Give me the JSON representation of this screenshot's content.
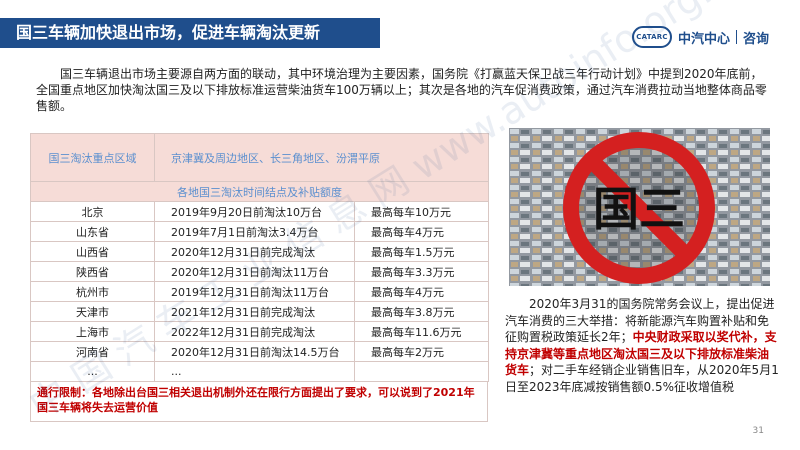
{
  "title": "国三车辆加快退出市场，促进车辆淘汰更新",
  "logo": {
    "badge_text": "CATARC",
    "name": "中汽中心",
    "sub": "咨询"
  },
  "intro": "国三车辆退出市场主要源自两方面的联动，其中环境治理为主要因素，国务院《打赢蓝天保卫战三年行动计划》中提到2020年底前，全国重点地区加快淘汰国三及以下排放标准运营柴油货车100万辆以上；其次是各地的汽车促消费政策，通过汽车消费拉动当地整体商品零售额。",
  "table": {
    "head_label": "国三淘汰重点区域",
    "head_value": "京津冀及周边地区、长三角地区、汾渭平原",
    "sub_head": "各地国三淘汰时间结点及补贴额度",
    "rows": [
      {
        "region": "北京",
        "time": "2019年9月20日前淘汰10万台",
        "subsidy": "最高每车10万元"
      },
      {
        "region": "山东省",
        "time": "2019年7月1日前淘汰3.4万台",
        "subsidy": "最高每车4万元"
      },
      {
        "region": "山西省",
        "time": "2020年12月31日前完成淘汰",
        "subsidy": "最高每车1.5万元"
      },
      {
        "region": "陕西省",
        "time": "2020年12月31日前淘汰11万台",
        "subsidy": "最高每车3.3万元"
      },
      {
        "region": "杭州市",
        "time": "2019年12月31日前淘汰11万台",
        "subsidy": "最高每车4万元"
      },
      {
        "region": "天津市",
        "time": "2021年12月31日前完成淘汰",
        "subsidy": "最高每车3.8万元"
      },
      {
        "region": "上海市",
        "time": "2022年12月31日前完成淘汰",
        "subsidy": "最高每车11.6万元"
      },
      {
        "region": "河南省",
        "time": "2020年12月31日前淘汰14.5万台",
        "subsidy": "最高每车2万元"
      },
      {
        "region": "...",
        "time": "...",
        "subsidy": ""
      }
    ],
    "footer_label": "通行限制",
    "footer_text": "：各地除出台国三相关退出机制外还在限行方面提出了要求，可以说到了2021年国三车辆将失去运营价值"
  },
  "image": {
    "sign_text": "国三",
    "sign_color": "#d42020"
  },
  "caption": {
    "part1": "2020年3月31的国务院常务会议上，提出促进汽车消费的三大举措：将新能源汽车购置补贴和免征购置税政策延长2年；",
    "highlight": "中央财政采取以奖代补，支持京津冀等重点地区淘汰国三及以下排放标准柴油货车",
    "part2": "；对二手车经销企业销售旧车，从2020年5月1日至2023年底减按销售额0.5%征收增值税"
  },
  "watermark": "中 国 汽 车 工 业 信 息 网 www.autoinfo.org.cn",
  "page_number": "31",
  "colors": {
    "brand": "#1f4e8c",
    "table_head_bg": "#f6dcd7",
    "table_head_text": "#5b8fcf",
    "highlight": "#c00000"
  }
}
